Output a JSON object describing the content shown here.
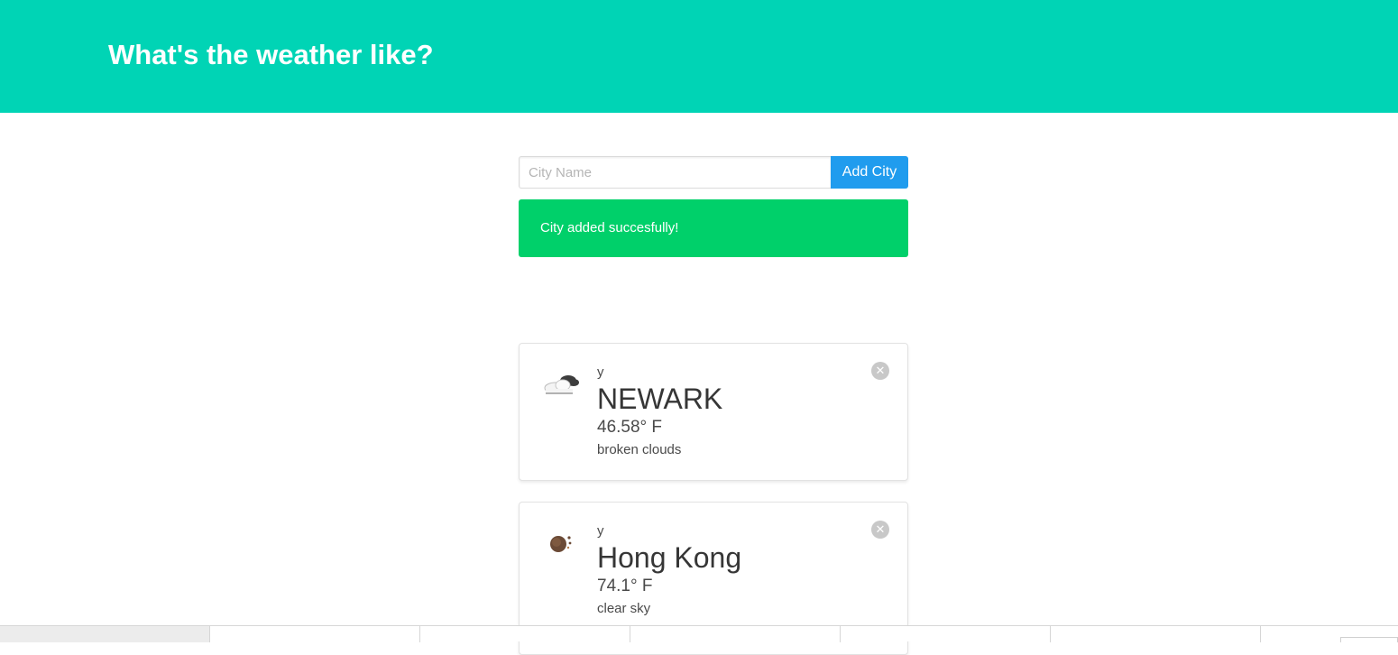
{
  "header": {
    "title": "What's the weather like?"
  },
  "form": {
    "input_placeholder": "City Name",
    "input_value": "",
    "add_button_label": "Add City"
  },
  "notification": {
    "message": "City added succesfully!"
  },
  "cities": [
    {
      "prefix": "y",
      "name": "NEWARK",
      "temperature": "46.58° F",
      "description": "broken clouds",
      "icon": "broken-clouds-icon"
    },
    {
      "prefix": "y",
      "name": "Hong Kong",
      "temperature": "74.1° F",
      "description": "clear sky",
      "icon": "clear-sky-icon"
    }
  ],
  "delete_glyph": "✕",
  "colors": {
    "hero": "#00d4b5",
    "button": "#209cee",
    "notification": "#00d06a"
  }
}
